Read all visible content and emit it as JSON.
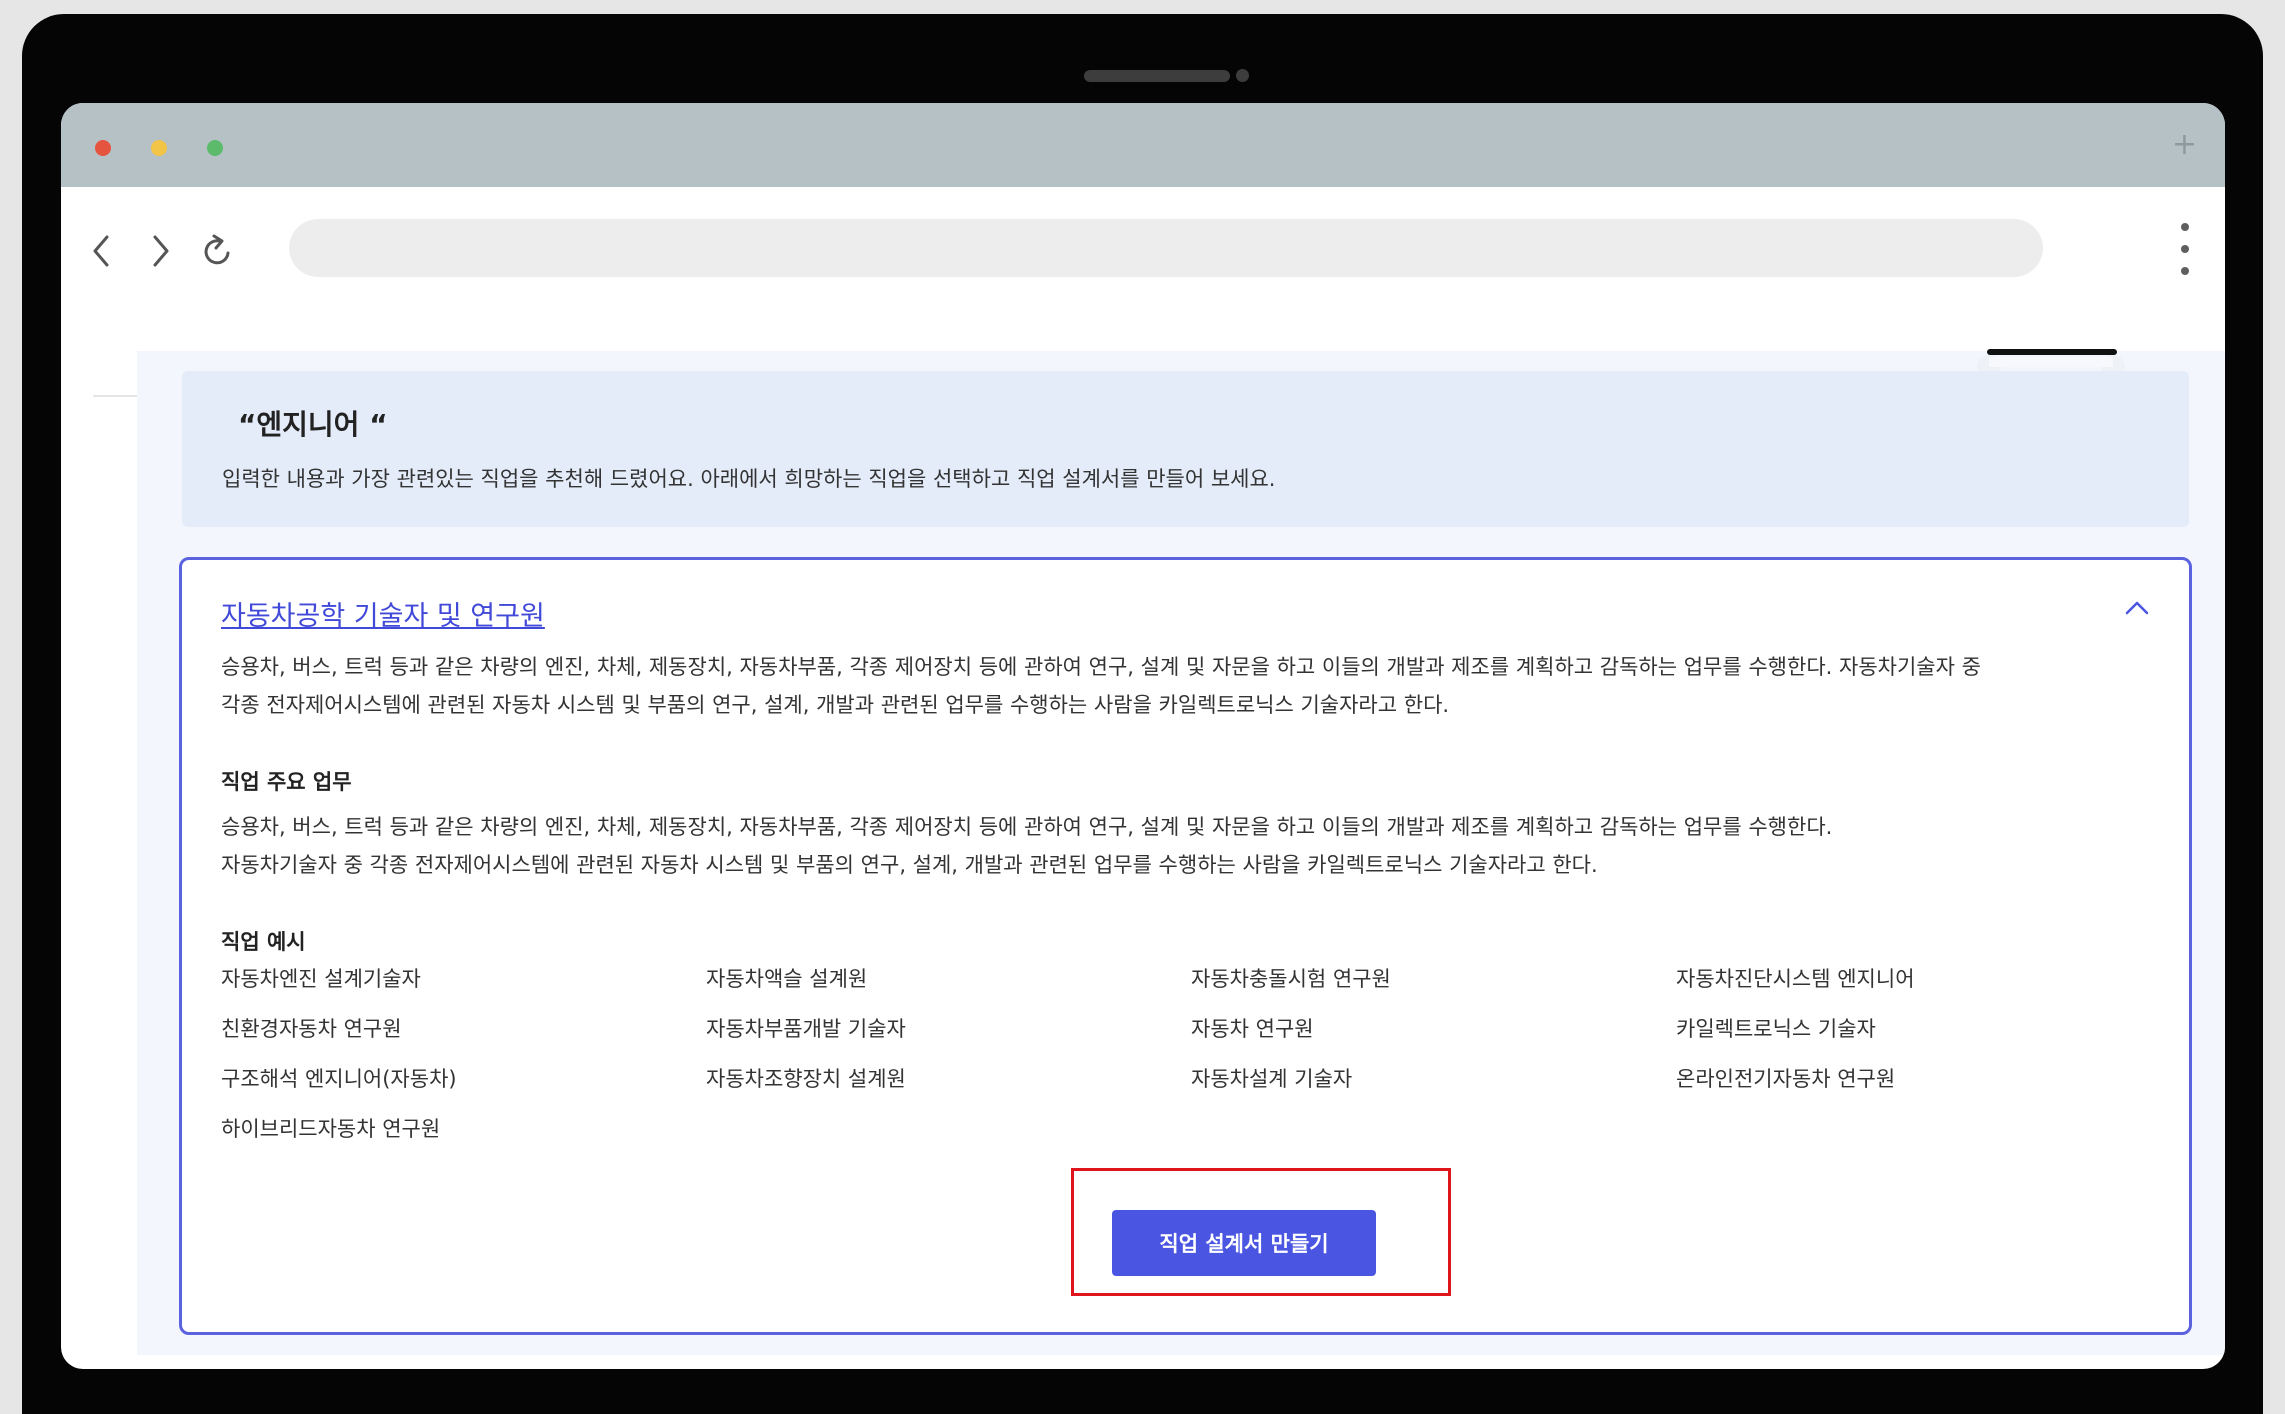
{
  "browser": {
    "new_tab_label": "+",
    "url": ""
  },
  "intro": {
    "title": "“엔지니어 “",
    "description": "입력한 내용과 가장 관련있는 직업을 추천해 드렸어요. 아래에서 희망하는 직업을 선택하고 직업 설계서를 만들어 보세요."
  },
  "job": {
    "title": "자동차공학 기술자 및 연구원",
    "description_lines": [
      "승용차, 버스, 트럭 등과 같은 차량의 엔진, 차체, 제동장치, 자동차부품, 각종 제어장치 등에 관하여 연구, 설계 및 자문을 하고 이들의 개발과 제조를 계획하고 감독하는 업무를 수행한다. 자동차기술자 중",
      "각종 전자제어시스템에 관련된 자동차 시스템 및 부품의 연구, 설계, 개발과 관련된 업무를 수행하는 사람을 카일렉트로닉스 기술자라고 한다."
    ],
    "duties_title": "직업 주요 업무",
    "duties_lines": [
      "승용차, 버스, 트럭 등과 같은 차량의 엔진, 차체, 제동장치, 자동차부품, 각종 제어장치 등에 관하여 연구, 설계 및 자문을 하고 이들의 개발과 제조를 계획하고 감독하는 업무를 수행한다.",
      "자동차기술자 중 각종 전자제어시스템에 관련된 자동차 시스템 및 부품의 연구, 설계, 개발과 관련된 업무를 수행하는 사람을 카일렉트로닉스 기술자라고 한다."
    ],
    "examples_title": "직업 예시",
    "examples": [
      "자동차엔진 설계기술자",
      "자동차액슬 설계원",
      "자동차충돌시험 연구원",
      "자동차진단시스템 엔지니어",
      "친환경자동차 연구원",
      "자동차부품개발 기술자",
      "자동차 연구원",
      "카일렉트로닉스 기술자",
      "구조해석 엔지니어(자동차)",
      "자동차조향장치 설계원",
      "자동차설계 기술자",
      "온라인전기자동차 연구원",
      "하이브리드자동차 연구원"
    ],
    "cta_label": "직업 설계서 만들기"
  },
  "icons": {
    "back": "chevron-left-icon",
    "forward": "chevron-right-icon",
    "reload": "reload-icon",
    "menu": "kebab-menu-icon",
    "collapse": "chevron-up-icon"
  },
  "colors": {
    "accent": "#4a56e2",
    "link": "#4149d8",
    "highlight": "#e0141c",
    "intro_bg": "#e4ecfa"
  }
}
